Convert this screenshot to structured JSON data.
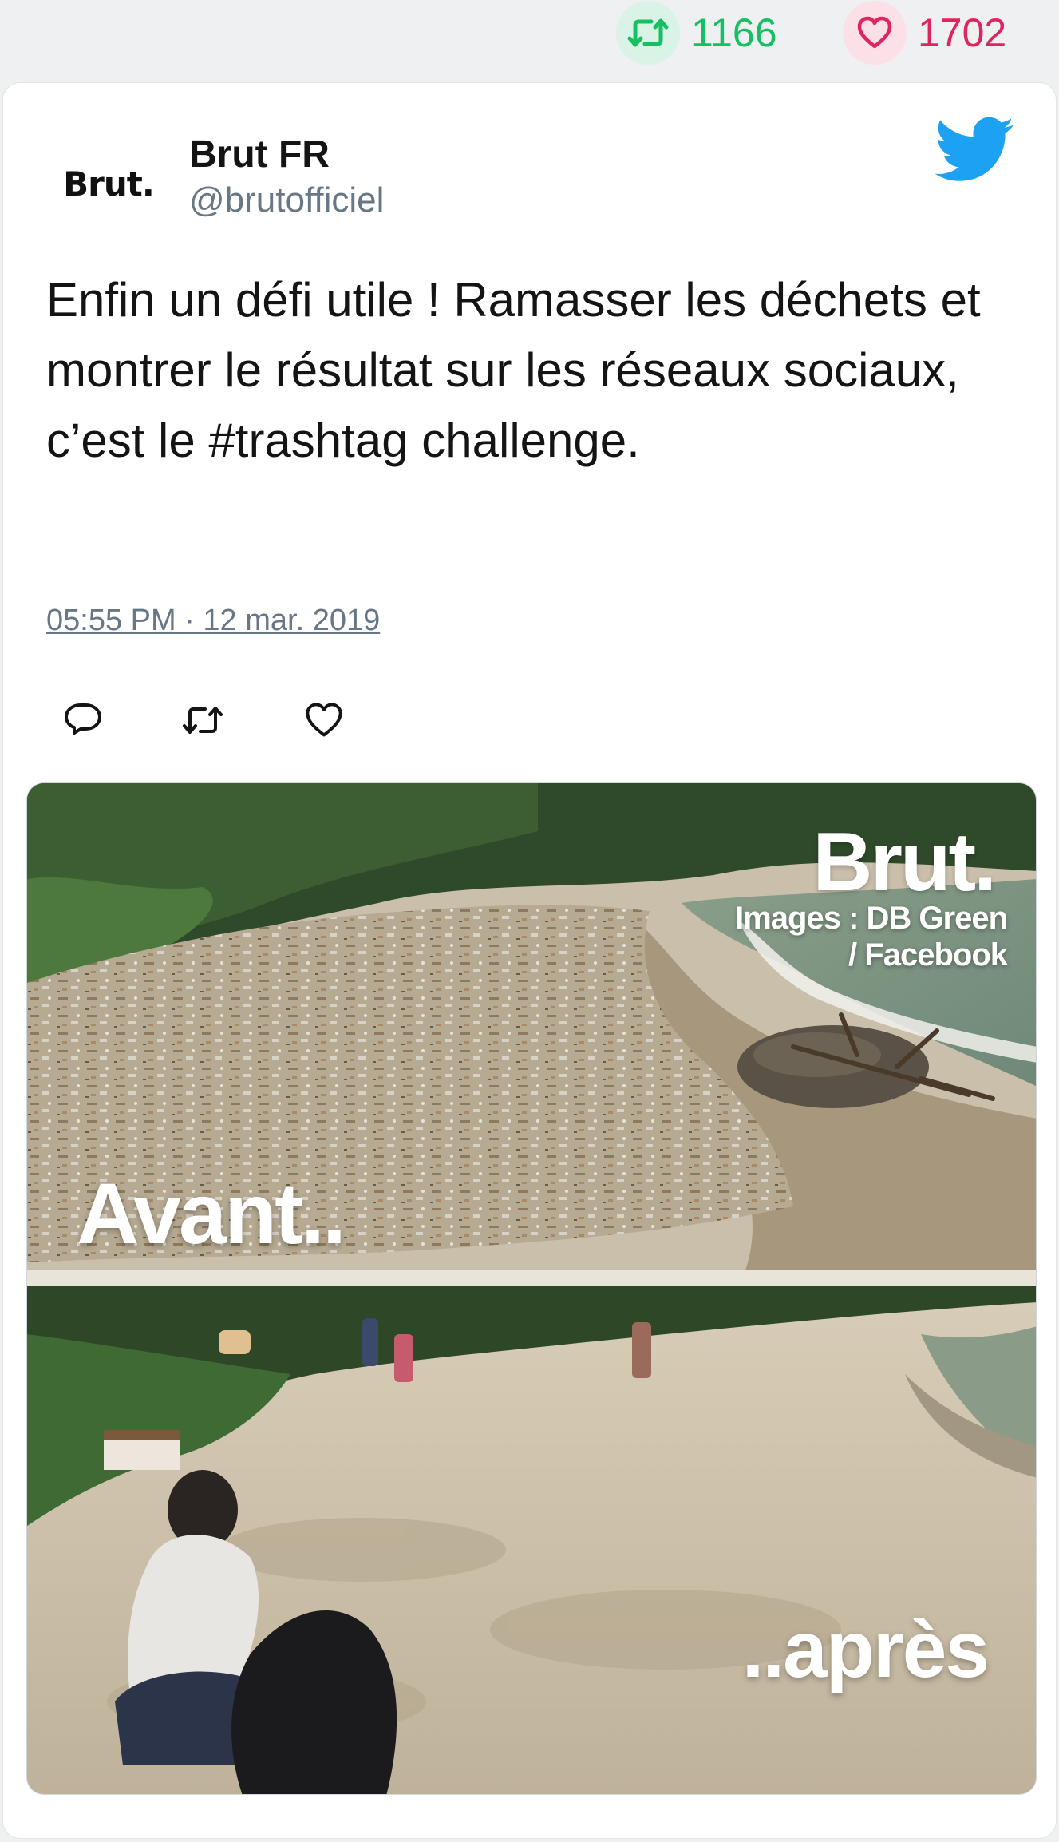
{
  "stats": {
    "retweets": "1166",
    "likes": "1702"
  },
  "author": {
    "avatar_text": "Brut.",
    "name": "Brut FR",
    "handle": "@brutofficiel"
  },
  "tweet": {
    "text": "Enfin un défi utile ! Ramasser les déchets et montrer le résultat sur les réseaux sociaux, c’est le #trashtag challenge.",
    "timestamp": "05:55 PM · 12 mar. 2019"
  },
  "media": {
    "watermark": "Brut.",
    "credit_line1": "Images : DB Green",
    "credit_line2": "/ Facebook",
    "label_before": "Avant..",
    "label_after": "..après"
  },
  "icons": {
    "retweet": "retweet-icon",
    "like": "heart-icon",
    "reply": "reply-icon",
    "brand": "twitter-bird-icon"
  },
  "colors": {
    "retweet": "#17bf63",
    "like": "#e0245e",
    "twitter_blue": "#1da1f2",
    "muted": "#687785"
  }
}
